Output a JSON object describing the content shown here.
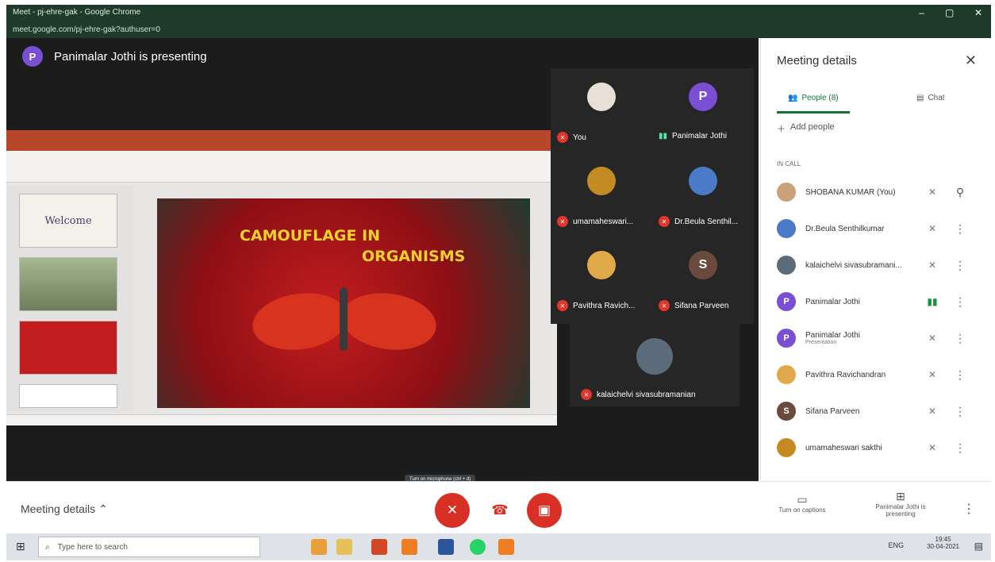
{
  "browser": {
    "title": "Meet - pj-ehre-gak - Google Chrome",
    "url": "meet.google.com/pj-ehre-gak?authuser=0"
  },
  "presenter": {
    "initial": "P",
    "text": "Panimalar Jothi is presenting",
    "color": "#7b4fd4"
  },
  "slide": {
    "title_line1": "CAMOUFLAGE IN",
    "title_line2": "ORGANISMS",
    "thumb1_text": "Welcome"
  },
  "tiles": [
    {
      "label": "You",
      "muted": true,
      "avatar": "photo",
      "color": "#e8e0d6"
    },
    {
      "label": "Panimalar Jothi",
      "muted": false,
      "avatar": "P",
      "color": "#7b4fd4"
    },
    {
      "label": "umamaheswari...",
      "muted": true,
      "avatar": "photo",
      "color": "#c48a24"
    },
    {
      "label": "Dr.Beula Senthil...",
      "muted": true,
      "avatar": "photo",
      "color": "#4a7ac8"
    },
    {
      "label": "Pavithra Ravich...",
      "muted": true,
      "avatar": "photo",
      "color": "#e0a94a"
    },
    {
      "label": "Sifana Parveen",
      "muted": true,
      "avatar": "S",
      "color": "#6b4a3e"
    }
  ],
  "bottom_tile": {
    "label": "kalaichelvi sivasubramanian"
  },
  "side": {
    "title": "Meeting details",
    "tab_people": "People (8)",
    "tab_chat": "Chat",
    "add_people": "Add people",
    "in_call": "IN CALL",
    "people": [
      {
        "name": "SHOBANA KUMAR (You)",
        "sub": "",
        "initial": "",
        "color": "#c9a27a"
      },
      {
        "name": "Dr.Beula Senthilkumar",
        "sub": "",
        "initial": "",
        "color": "#4a7ac8"
      },
      {
        "name": "kalaichelvi sivasubramani...",
        "sub": "",
        "initial": "",
        "color": "#5b6b7a"
      },
      {
        "name": "Panimalar Jothi",
        "sub": "",
        "initial": "P",
        "color": "#7b4fd4"
      },
      {
        "name": "Panimalar Jothi",
        "sub": "Presentation",
        "initial": "P",
        "color": "#7b4fd4"
      },
      {
        "name": "Pavithra Ravichandran",
        "sub": "",
        "initial": "",
        "color": "#e0a94a"
      },
      {
        "name": "Sifana Parveen",
        "sub": "",
        "initial": "S",
        "color": "#6b4a3e"
      },
      {
        "name": "umamaheswari sakthi",
        "sub": "",
        "initial": "",
        "color": "#c48a24"
      }
    ]
  },
  "bar": {
    "meeting_details": "Meeting details",
    "tooltip": "Turn on microphone (ctrl + d)",
    "captions": "Turn on captions",
    "presenting": "Panimalar Jothi is presenting"
  },
  "taskbar": {
    "search": "Type here to search",
    "time": "19:45",
    "date": "30-04-2021",
    "lang": "ENG"
  }
}
